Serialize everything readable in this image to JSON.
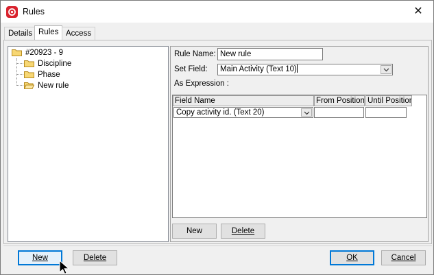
{
  "window": {
    "title": "Rules",
    "close_glyph": "✕"
  },
  "tabs": [
    {
      "label": "Details",
      "active": false
    },
    {
      "label": "Rules",
      "active": true
    },
    {
      "label": "Access",
      "active": false
    }
  ],
  "tree": {
    "root": {
      "label": "#20923 - 9",
      "icon": "folder-icon"
    },
    "children": [
      {
        "label": "Discipline",
        "icon": "folder-icon"
      },
      {
        "label": "Phase",
        "icon": "folder-icon"
      },
      {
        "label": "New rule",
        "icon": "folder-open-icon"
      }
    ]
  },
  "rule_form": {
    "rule_name_label": "Rule Name:",
    "rule_name_value": "New rule",
    "set_field_label": "Set Field:",
    "set_field_value": "Main Activity (Text 10)",
    "as_expression_label": "As Expression :"
  },
  "field_grid": {
    "columns": [
      "Field Name",
      "From Position",
      "Until Position"
    ],
    "rows": [
      {
        "field_name": "Copy activity id. (Text 20)",
        "from_position": "",
        "until_position": ""
      }
    ]
  },
  "grid_buttons": {
    "new": "New",
    "delete": "Delete"
  },
  "footer_buttons": {
    "new": "New",
    "delete": "Delete",
    "ok": "OK",
    "cancel": "Cancel"
  },
  "colors": {
    "app_icon": "#d9232e",
    "focus_border": "#0078d7",
    "window_bg": "#f0f0f0"
  }
}
